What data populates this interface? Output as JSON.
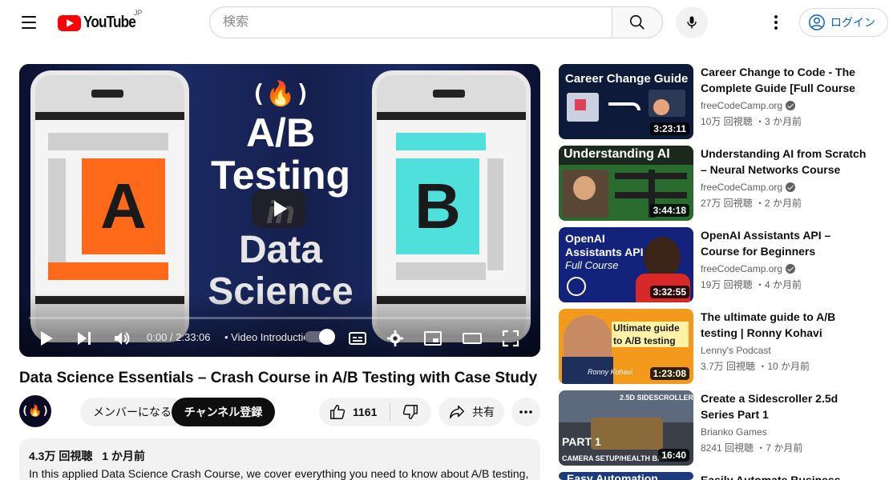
{
  "header": {
    "logo_text": "YouTube",
    "region": "JP",
    "search_placeholder": "検索",
    "login_label": "ログイン"
  },
  "player": {
    "thumb_title": [
      "A/B",
      "Testing",
      "in",
      "Data",
      "Science"
    ],
    "fcc_logo": "(🔥)",
    "letter_a": "A",
    "letter_b": "B",
    "time": "0:00 / 2:33:06",
    "chapter": "• Video Introduction",
    "progress": 0
  },
  "video": {
    "title": "Data Science Essentials – Crash Course in A/B Testing with Case Study",
    "member_label": "メンバーになる",
    "subscribe_label": "チャンネル登録",
    "like_count": "1161",
    "share_label": "共有",
    "views": "4.3万 回視聴",
    "posted": "1 か月前",
    "description": "In this applied Data Science Crash Course, we cover everything you need to know about A/B testing,"
  },
  "recommendations": [
    {
      "title": "Career Change to Code - The Complete Guide [Full Course f…",
      "channel": "freeCodeCamp.org",
      "verified": true,
      "meta": "10万 回視聴 ・3 か月前",
      "duration": "3:23:11",
      "thumb_text": "Career Change Guide"
    },
    {
      "title": "Understanding AI from Scratch – Neural Networks Course",
      "channel": "freeCodeCamp.org",
      "verified": true,
      "meta": "27万 回視聴 ・2 か月前",
      "duration": "3:44:18",
      "thumb_text": "Understanding AI"
    },
    {
      "title": "OpenAI Assistants API – Course for Beginners",
      "channel": "freeCodeCamp.org",
      "verified": true,
      "meta": "19万 回視聴 ・4 か月前",
      "duration": "3:32:55",
      "thumb_text": "OpenAI Assistants API",
      "thumb_sub": "Full Course"
    },
    {
      "title": "The ultimate guide to A/B testing | Ronny Kohavi (Airbnb,…",
      "channel": "Lenny's Podcast",
      "verified": false,
      "meta": "3.7万 回視聴 ・10 か月前",
      "duration": "1:23:08",
      "thumb_text": "Ultimate guide to A/B testing",
      "thumb_sub": "Ronny Kohavi"
    },
    {
      "title": "Create a Sidescroller 2.5d Series Part 1",
      "channel": "Brianko Games",
      "verified": false,
      "meta": "8241 回視聴 ・7 か月前",
      "duration": "16:40",
      "thumb_text": "2.5D SIDESCROLLER SERIES",
      "thumb_sub": "PART 1",
      "thumb_sub2": "CAMERA SETUP/HEALTH BAR"
    },
    {
      "title": "Easily Automate Business Tasks",
      "thumb_text": "Easy Automation"
    }
  ],
  "colors": {
    "brand_red": "#ff0000",
    "link_blue": "#065fd4",
    "text_primary": "#0f0f0f",
    "text_secondary": "#606060",
    "chip_bg": "#f2f2f2",
    "letter_a_bg": "#ff6a1a",
    "letter_b_bg": "#4fe0dc"
  }
}
